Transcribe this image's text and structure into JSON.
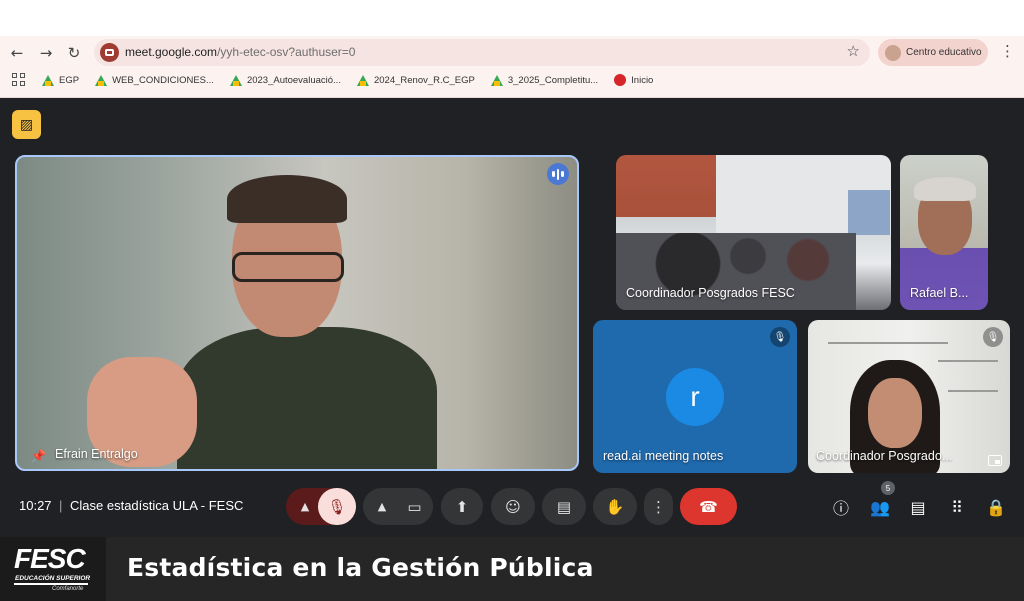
{
  "browser": {
    "url_domain": "meet.google.com",
    "url_path": "/yyh-etec-osv?authuser=0",
    "profile_label": "Centro educativo",
    "bookmarks": [
      {
        "label": "EGP",
        "icon": "drive-icon"
      },
      {
        "label": "WEB_CONDICIONES...",
        "icon": "drive-icon"
      },
      {
        "label": "2023_Autoevaluació...",
        "icon": "drive-icon"
      },
      {
        "label": "2024_Renov_R.C_EGP",
        "icon": "drive-icon"
      },
      {
        "label": "3_2025_Completitu...",
        "icon": "drive-icon"
      },
      {
        "label": "Inicio",
        "icon": "fesc-icon"
      }
    ]
  },
  "meet": {
    "tiles": [
      {
        "name": "Efrain Entralgo"
      },
      {
        "name": "Coordinador Posgrados FESC"
      },
      {
        "name": "Rafael B..."
      },
      {
        "name": "read.ai meeting notes",
        "avatar_letter": "r"
      },
      {
        "name": "Coordinador Posgrado..."
      }
    ],
    "time": "10:27",
    "separator": "|",
    "meeting_name": "Clase estadística ULA - FESC",
    "participants_count": "5"
  },
  "banner": {
    "logo_text": "FESC",
    "logo_subtitle": "EDUCACIÓN SUPERIOR",
    "logo_small": "Comfanorte",
    "title": "Estadística en la Gestión Pública"
  },
  "colors": {
    "accent_outline": "#a8c7fa",
    "end_call": "#dc362e",
    "meet_bg": "#202124",
    "read_tile": "#1f69ad"
  }
}
